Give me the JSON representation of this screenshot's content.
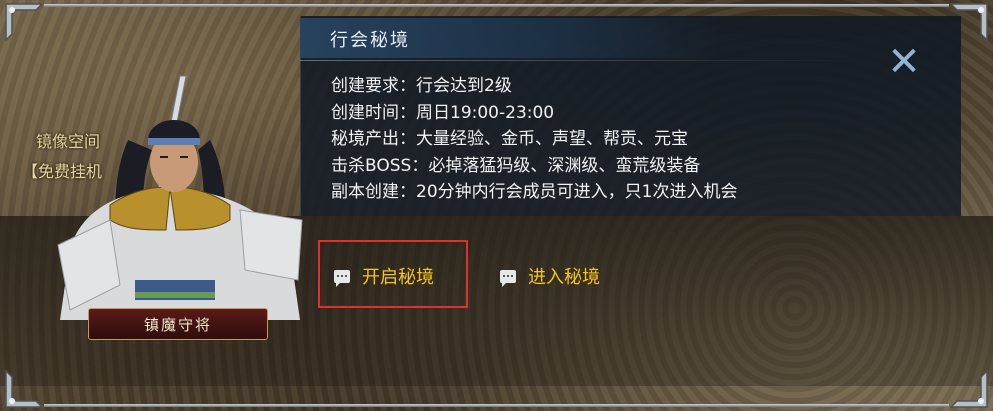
{
  "dialog": {
    "title": "行会秘境",
    "info_rows": [
      "创建要求：行会达到2级",
      "创建时间：周日19:00-23:00",
      "秘境产出：大量经验、金币、声望、帮贡、元宝",
      "击杀BOSS：必掉落猛犸级、深渊级、蛮荒级装备",
      "副本创建：20分钟内行会成员可进入，只1次进入机会"
    ],
    "buttons": {
      "open_label": "开启秘境",
      "enter_label": "进入秘境"
    },
    "close_icon": "close-x-icon"
  },
  "npc": {
    "name": "镇魔守将"
  },
  "side_labels": {
    "mirror_space": "镜像空间",
    "free_hangup": "【免费挂机"
  },
  "colors": {
    "button_text": "#f4c51c",
    "highlight_border": "#e03030",
    "close_icon": "#8fb4d4"
  }
}
